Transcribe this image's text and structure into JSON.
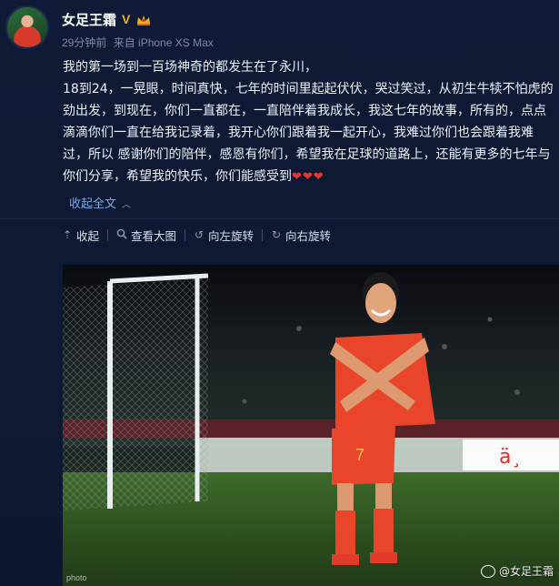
{
  "post": {
    "author": "女足王霜",
    "verified_badge": "V",
    "time": "29分钟前",
    "source": "来自 iPhone XS Max",
    "content_lines": [
      "我的第一场到一百场神奇的都发生在了永川，",
      "18到24，一晃眼，时间真快，七年的时间里起起伏伏，哭过笑过，从初生牛犊不怕虎的劲出发，到现在，你们一直都在，一直陪伴着我成长，我这七年的故事，所有的，点点滴滴你们一直在给我记录着，我开心你们跟着我一起开心，我难过你们也会跟着我难过，所以 感谢你们的陪伴，感恩有你们，希望我在足球的道路上，还能有更多的七年与你们分享，希望我的快乐，你们能感受到"
    ],
    "hearts": "❤❤❤",
    "collapse_label": "收起全文",
    "collapse_icon": "chevron-up-icon"
  },
  "toolbar": {
    "items": [
      {
        "label": "收起",
        "icon": "collapse-arrow-icon"
      },
      {
        "label": "查看大图",
        "icon": "magnify-icon"
      },
      {
        "label": "向左旋转",
        "icon": "rotate-left-icon"
      },
      {
        "label": "向右旋转",
        "icon": "rotate-right-icon"
      }
    ]
  },
  "photo": {
    "credit": "photo",
    "watermark": "@女足王霜",
    "jersey_number": "7"
  },
  "colors": {
    "background": "#0e1a33",
    "link": "#7aa7e6",
    "badge": "#f2b01e",
    "heart": "#e8362c",
    "jersey": "#e8452a"
  }
}
